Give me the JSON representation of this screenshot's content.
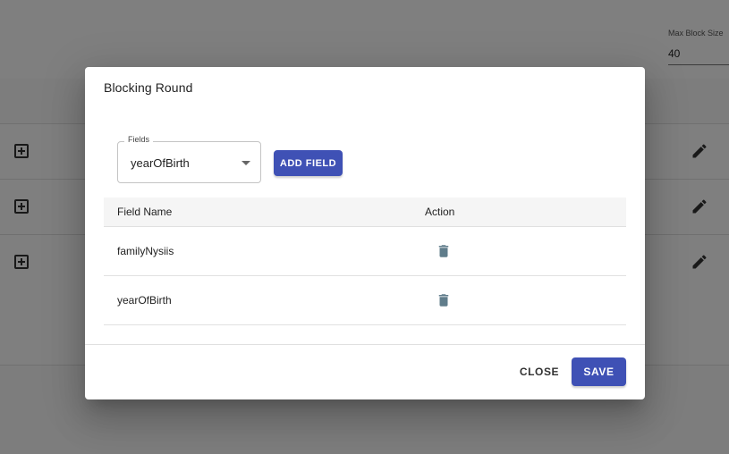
{
  "background": {
    "max_block_size_label": "Max Block Size",
    "max_block_size_value": "40"
  },
  "dialog": {
    "title": "Blocking Round",
    "fields_label": "Fields",
    "fields_selected": "yearOfBirth",
    "add_field_label": "ADD FIELD",
    "table": {
      "columns": [
        "Field Name",
        "Action"
      ],
      "rows": [
        {
          "field_name": "familyNysiis",
          "action_icon": "delete-icon"
        },
        {
          "field_name": "yearOfBirth",
          "action_icon": "delete-icon"
        }
      ]
    },
    "close_label": "CLOSE",
    "save_label": "SAVE"
  },
  "colors": {
    "primary": "#3f51b5",
    "icon_grey": "#607d8b",
    "backdrop": "rgba(0,0,0,0.5)"
  }
}
